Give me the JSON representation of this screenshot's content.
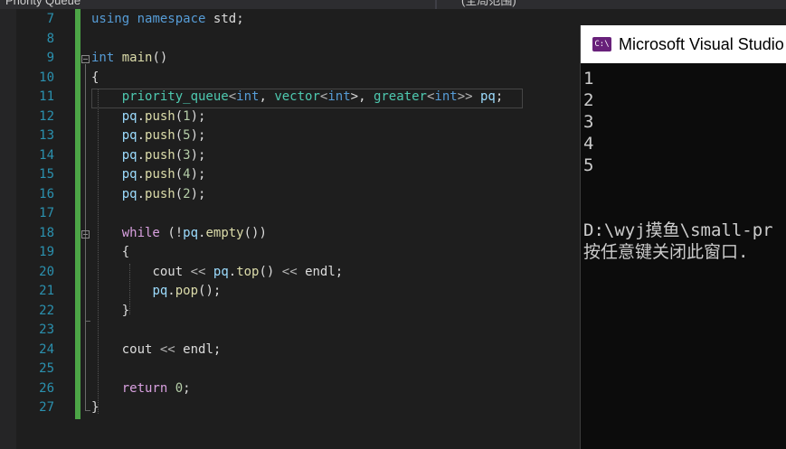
{
  "tabs": {
    "left_title": "Priority Queue",
    "right_title": "(全局范围)"
  },
  "editor": {
    "line_numbers": [
      "7",
      "8",
      "9",
      "10",
      "11",
      "12",
      "13",
      "14",
      "15",
      "16",
      "17",
      "18",
      "19",
      "20",
      "21",
      "22",
      "23",
      "24",
      "25",
      "26",
      "27"
    ],
    "code": {
      "l7": [
        "using",
        "namespace",
        "std",
        ";"
      ],
      "l9": [
        "int",
        "main",
        "()"
      ],
      "l10": [
        "{"
      ],
      "l11": [
        "priority_queue",
        "<",
        "int",
        ", ",
        "vector",
        "<",
        "int",
        ">, ",
        "greater",
        "<",
        "int",
        ">>",
        "pq",
        ";"
      ],
      "l12": [
        "pq",
        ".",
        "push",
        "(",
        "1",
        ");"
      ],
      "l13": [
        "pq",
        ".",
        "push",
        "(",
        "5",
        ");"
      ],
      "l14": [
        "pq",
        ".",
        "push",
        "(",
        "3",
        ");"
      ],
      "l15": [
        "pq",
        ".",
        "push",
        "(",
        "4",
        ");"
      ],
      "l16": [
        "pq",
        ".",
        "push",
        "(",
        "2",
        ");"
      ],
      "l18": [
        "while",
        "(!",
        "pq",
        ".",
        "empty",
        "())"
      ],
      "l19": [
        "{"
      ],
      "l20": [
        "cout",
        "<<",
        "pq",
        ".",
        "top",
        "()",
        "<<",
        "endl",
        ";"
      ],
      "l21": [
        "pq",
        ".",
        "pop",
        "();"
      ],
      "l22": [
        "}"
      ],
      "l24": [
        "cout",
        "<<",
        "endl",
        ";"
      ],
      "l26": [
        "return",
        "0",
        ";"
      ],
      "l27": [
        "}"
      ]
    }
  },
  "console": {
    "title": "Microsoft Visual Studio",
    "icon_label": "C:\\",
    "output": [
      "1",
      "2",
      "3",
      "4",
      "5",
      "",
      "",
      "D:\\wyj摸鱼\\small-pr",
      "按任意键关闭此窗口."
    ]
  },
  "colors": {
    "editor_bg": "#1e1e1e",
    "keyword": "#569cd6",
    "control_keyword": "#d8a0df",
    "type": "#4ec9b0",
    "function": "#dcdcaa",
    "variable": "#9cdcfe",
    "number": "#b5cea8",
    "line_number": "#2b91af",
    "change_bar": "#4ca546",
    "console_bg": "#0c0c0c"
  }
}
